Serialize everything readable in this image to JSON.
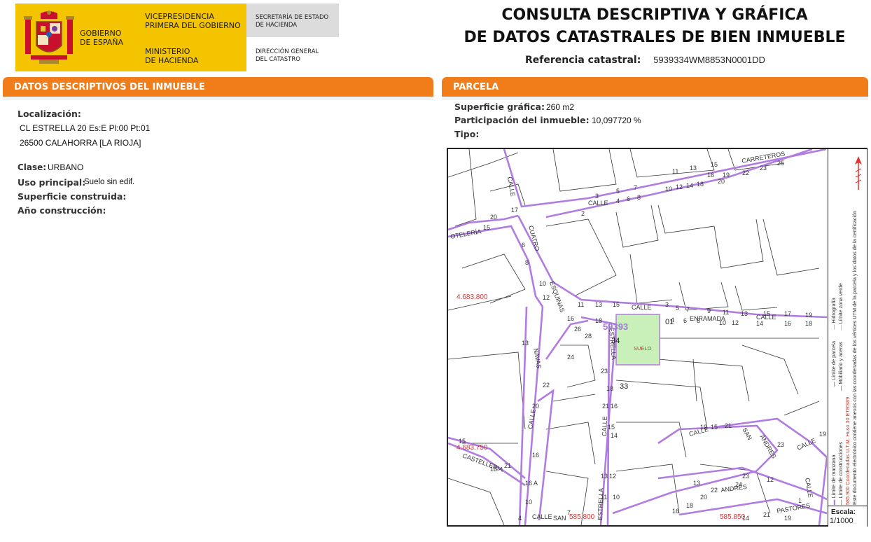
{
  "header": {
    "gov_line1": "GOBIERNO",
    "gov_line2": "DE ESPAÑA",
    "vice_line1": "VICEPRESIDENCIA",
    "vice_line2": "PRIMERA DEL GOBIERNO",
    "min_line1": "MINISTERIO",
    "min_line2": "DE HACIENDA",
    "sec_line1": "SECRETARÍA DE ESTADO",
    "sec_line2": "DE HACIENDA",
    "dir_line1": "DIRECCIÓN GENERAL",
    "dir_line2": "DEL CATASTRO",
    "title_line1": "CONSULTA DESCRIPTIVA Y GRÁFICA",
    "title_line2": "DE DATOS CATASTRALES DE BIEN INMUEBLE",
    "ref_label": "Referencia catastral:",
    "ref_value": "5939334WM8853N0001DD",
    "brand_color": "#f4c400"
  },
  "descriptivos": {
    "heading": "DATOS DESCRIPTIVOS DEL INMUEBLE",
    "localizacion_label": "Localización:",
    "address_line1": "CL ESTRELLA 20 Es:E Pl:00 Pt:01",
    "address_line2": "26500 CALAHORRA [LA RIOJA]",
    "clase_label": "Clase:",
    "clase_value": "URBANO",
    "uso_label": "Uso principal:",
    "uso_value": "Suelo sin edif.",
    "superficie_construida_label": "Superficie construida:",
    "anio_label": "Año construcción:",
    "bar_color": "#f07d1a"
  },
  "parcela": {
    "heading": "PARCELA",
    "superficie_label": "Superficie gráfica:",
    "superficie_value": "260 m2",
    "participacion_label": "Participación del inmueble:",
    "participacion_value": "10,097720 %",
    "tipo_label": "Tipo:"
  },
  "map": {
    "coord_y1": "4.683.800",
    "coord_y2": "4.683.750",
    "coord_x1": "585.800",
    "coord_x2": "585.850",
    "parcel_number": "59393",
    "parcel_sub": "34",
    "suelo_label": "SUELO",
    "label_01": "01",
    "label_33": "33",
    "legend_line1": "Límite de manzana",
    "legend_line2": "Límite de parcela",
    "legend_line3": "Hidrografía",
    "legend_line4": "Límite de construcciones",
    "legend_line5": "Mobiliario y aceras",
    "legend_line6": "Límite zona verde",
    "legend_coords": "585.900 Coordenadas U.T.M. Huso 30 ETRS89",
    "legend_note": "Este documento electrónico contiene anexos con las coordenadas de los vértices UTM de la parcela y los datos de la certificación",
    "scale_label": "Escala:",
    "scale_value": "1/1000",
    "street_color": "#b07ce0",
    "parcel_color": "#c8f0b8",
    "streets": {
      "calle": "CALLE",
      "carreteros": "CARRETEROS",
      "cuatro": "CUATRO",
      "esquinas": "ESQUINAS",
      "navas": "NAVAS",
      "estrella": "ESTRELLA",
      "enramada": "ENRAMADA",
      "castelleria": "CASTELLERIA",
      "oteleria": "OTELERÍA",
      "san": "SAN",
      "andres": "ANDRES",
      "andres_accent": "ANDRÉS",
      "pastores": "PASTORES"
    }
  }
}
